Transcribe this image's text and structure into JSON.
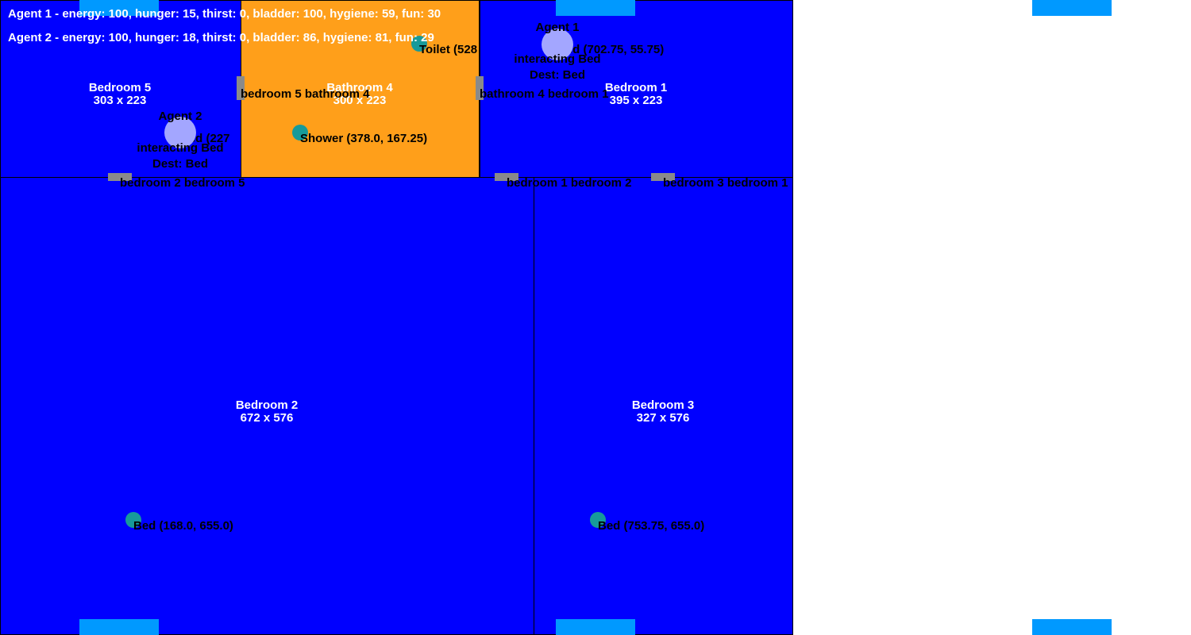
{
  "colors": {
    "bedroom": "#0000ff",
    "bathroom": "#ff9f1a",
    "door": "#8a8a8a",
    "object": "#179a9a",
    "agent": "#a3a6ff",
    "window": "#0099ff"
  },
  "rooms": {
    "bedroom5": {
      "name": "Bedroom 5",
      "size": "303 x 223"
    },
    "bathroom4": {
      "name": "Bathroom 4",
      "size": "300 x 223"
    },
    "bedroom1": {
      "name": "Bedroom 1",
      "size": "395 x 223"
    },
    "bedroom2": {
      "name": "Bedroom 2",
      "size": "672 x 576"
    },
    "bedroom3": {
      "name": "Bedroom 3",
      "size": "327 x 576"
    }
  },
  "doors": {
    "bedroom5_bathroom4": "bedroom 5 bathroom 4",
    "bathroom4_bedroom1": "bathroom 4 bedroom 1",
    "bedroom2_bedroom5": "bedroom 2 bedroom 5",
    "bedroom1_bedroom2": "bedroom 1 bedroom 2",
    "bedroom3_bedroom1": "bedroom 3 bedroom 1"
  },
  "objects": {
    "toilet": "Toilet (528",
    "shower": "Shower (378.0, 167.25)",
    "bed_bedroom1": "Bed (702.75, 55.75)",
    "bed_bedroom5": "Bed (227",
    "bed_bedroom2": "Bed (168.0, 655.0)",
    "bed_bedroom3": "Bed (753.75, 655.0)"
  },
  "agents": {
    "agent1": {
      "name": "Agent 1",
      "action": "interacting Bed",
      "dest": "Dest: Bed"
    },
    "agent2": {
      "name": "Agent 2",
      "action": "interacting Bed",
      "dest": "Dest: Bed"
    }
  },
  "status": {
    "agent1": "Agent 1 - energy: 100, hunger: 15, thirst: 0, bladder: 100, hygiene: 59, fun: 30",
    "agent2": "Agent 2 - energy: 100, hunger: 18, thirst: 0, bladder: 86, hygiene: 81, fun: 29"
  }
}
